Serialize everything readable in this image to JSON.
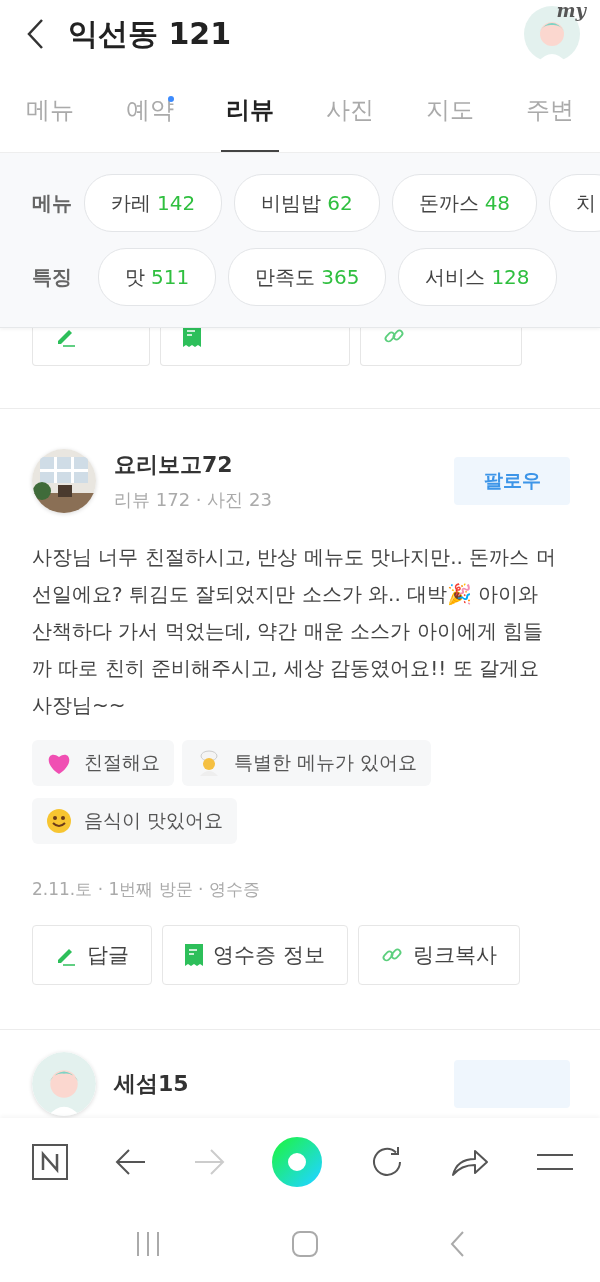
{
  "header": {
    "title": "익선동 121",
    "avatar_badge": "my"
  },
  "tabs": [
    {
      "label": "메뉴",
      "selected": false,
      "dot": false
    },
    {
      "label": "예약",
      "selected": false,
      "dot": true
    },
    {
      "label": "리뷰",
      "selected": true,
      "dot": false
    },
    {
      "label": "사진",
      "selected": false,
      "dot": false
    },
    {
      "label": "지도",
      "selected": false,
      "dot": false
    },
    {
      "label": "주변",
      "selected": false,
      "dot": false
    }
  ],
  "filters": [
    {
      "label": "메뉴",
      "chips": [
        {
          "name": "카레",
          "count": "142"
        },
        {
          "name": "비빔밥",
          "count": "62"
        },
        {
          "name": "돈까스",
          "count": "48"
        },
        {
          "name": "치"
        }
      ]
    },
    {
      "label": "특징",
      "chips": [
        {
          "name": "맛",
          "count": "511"
        },
        {
          "name": "만족도",
          "count": "365"
        },
        {
          "name": "서비스",
          "count": "128"
        }
      ]
    }
  ],
  "previous_actions": [
    {
      "kind": "pencil"
    },
    {
      "kind": "receipt"
    },
    {
      "kind": "link"
    }
  ],
  "review": {
    "author": "요리보고72",
    "stats": "리뷰 172 · 사진 23",
    "follow": "팔로우",
    "text": "사장님 너무 친절하시고, 반상 메뉴도 맛나지만.. 돈까스 머선일에요? 튀김도 잘되었지만 소스가 와.. 대박🎉 아이와 산책하다 가서 먹었는데, 약간 매운 소스가 아이에게 힘들까 따로 친히 준비해주시고, 세상 감동였어요!! 또 갈게요 사장님~~",
    "keywords": [
      {
        "kind": "heart",
        "label": "친절해요"
      },
      {
        "kind": "chef",
        "label": "특별한 메뉴가 있어요"
      },
      {
        "kind": "smile",
        "label": "음식이 맛있어요"
      }
    ],
    "meta": "2.11.토 · 1번째 방문 · 영수증",
    "actions": [
      "답글",
      "영수증 정보",
      "링크복사"
    ]
  },
  "next_review": {
    "author": "세섬15"
  }
}
